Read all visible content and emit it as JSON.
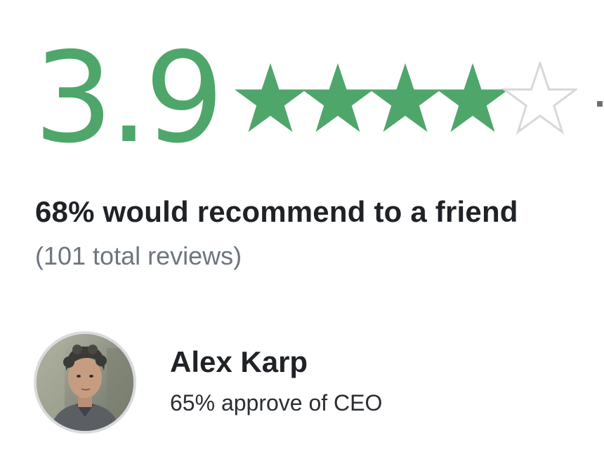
{
  "rating": {
    "value": "3.9",
    "max_stars": 5,
    "filled_fraction": 0.78,
    "color_filled": "#4fa66b",
    "color_empty_stroke": "#d6d8db"
  },
  "recommend": {
    "text": "68% would recommend to a friend"
  },
  "reviews": {
    "text": "(101 total reviews)"
  },
  "ceo": {
    "name": "Alex Karp",
    "approval": "65% approve of CEO",
    "avatar_icon": "person-photo-avatar"
  }
}
